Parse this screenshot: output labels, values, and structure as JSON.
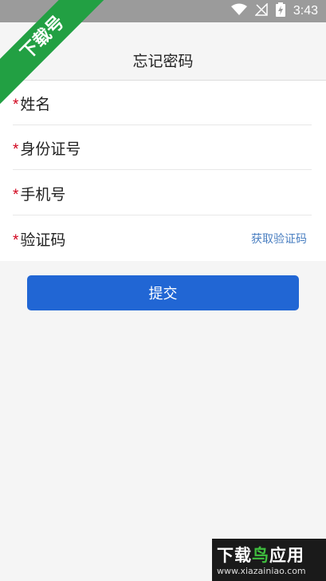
{
  "status_bar": {
    "time": "3:43",
    "icons": [
      "wifi-icon",
      "no-signal-icon",
      "battery-charging-icon"
    ]
  },
  "nav": {
    "title": "忘记密码",
    "back_icon": "back-arrow-icon"
  },
  "form": {
    "required_mark": "*",
    "fields": [
      {
        "label": "姓名"
      },
      {
        "label": "身份证号"
      },
      {
        "label": "手机号"
      },
      {
        "label": "验证码"
      }
    ],
    "get_code_label": "获取验证码"
  },
  "submit_label": "提交",
  "watermark": {
    "ribbon_text": "下载号",
    "logo_text_white": "下载",
    "logo_text_green": "鸟",
    "logo_text_tail": "应用",
    "logo_url": "www.xiazainiao.com"
  },
  "colors": {
    "accent": "#2166d4",
    "required": "#d0021b",
    "link": "#4a7fc1",
    "ribbon": "#22a043"
  }
}
